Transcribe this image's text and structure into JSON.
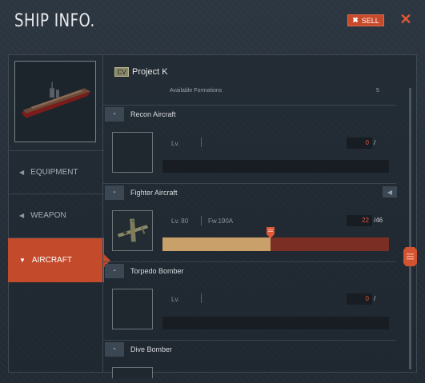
{
  "header": {
    "title": "SHIP INFO.",
    "sell_label": "SELL",
    "sell_icon": "close-x-icon",
    "close_icon": "close-icon"
  },
  "ship": {
    "type": "CV",
    "name": "Project K",
    "formations_label": "Available Formations",
    "formations_value": "5"
  },
  "sidebar": {
    "tabs": [
      {
        "label": "EQUIPMENT",
        "icon": "triangle-left-icon",
        "active": false
      },
      {
        "label": "WEAPON",
        "icon": "triangle-left-icon",
        "active": false
      },
      {
        "label": "AIRCRAFT",
        "icon": "triangle-down-icon",
        "active": true
      }
    ]
  },
  "aircraft": {
    "collapse_label": "-",
    "recon": {
      "title": "Recon Aircraft",
      "lv_label": "Lv.",
      "count": "0",
      "slash": "/"
    },
    "fighter": {
      "title": "Fighter Aircraft",
      "lv_label": "Lv. 80",
      "plane_name": "Fw.190A",
      "count": "22",
      "max": "/46",
      "fill_fraction": 0.478
    },
    "torpedo": {
      "title": "Torpedo Bomber",
      "lv_label": "Lv.",
      "count": "0",
      "slash": "/"
    },
    "dive": {
      "title": "Dive Bomber"
    }
  },
  "colors": {
    "accent": "#c34a2b",
    "count_text": "#e2553a",
    "bar_fill": "#c9a06a",
    "bar_empty": "#7a2e24"
  }
}
